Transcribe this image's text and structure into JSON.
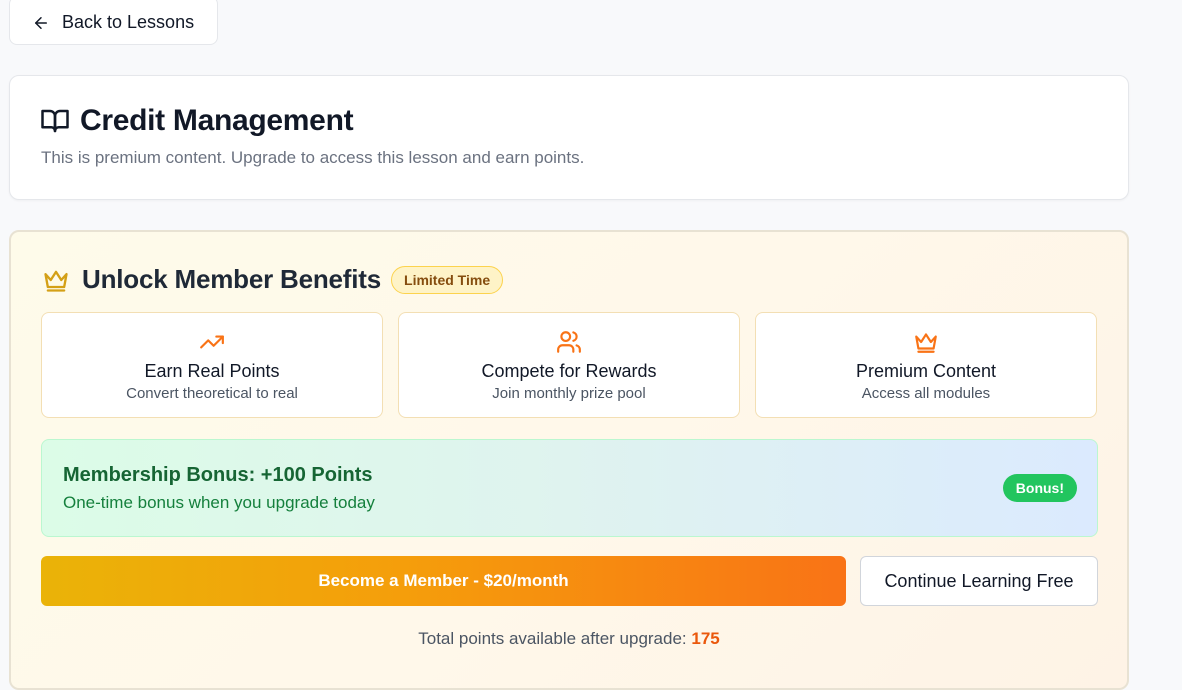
{
  "nav": {
    "back_label": "Back to Lessons",
    "back_icon": "arrow-left-icon"
  },
  "lesson": {
    "icon": "book-open-icon",
    "title": "Credit Management",
    "subtitle": "This is premium content. Upgrade to access this lesson and earn points."
  },
  "promo": {
    "icon": "crown-icon",
    "title": "Unlock Member Benefits",
    "badge": "Limited Time",
    "benefits": [
      {
        "icon": "trending-up-icon",
        "title": "Earn Real Points",
        "subtitle": "Convert theoretical to real"
      },
      {
        "icon": "users-icon",
        "title": "Compete for Rewards",
        "subtitle": "Join monthly prize pool"
      },
      {
        "icon": "crown-icon",
        "title": "Premium Content",
        "subtitle": "Access all modules"
      }
    ],
    "bonus": {
      "title": "Membership Bonus: +100 Points",
      "subtitle": "One-time bonus when you upgrade today",
      "badge": "Bonus!"
    },
    "member_button": "Become a Member - $20/month",
    "free_button": "Continue Learning Free",
    "total_label": "Total points available after upgrade: ",
    "total_points": "175"
  },
  "colors": {
    "accent_orange": "#f97316",
    "accent_gold": "#eab308",
    "bonus_green": "#22c55e",
    "points_orange": "#ea580c"
  }
}
